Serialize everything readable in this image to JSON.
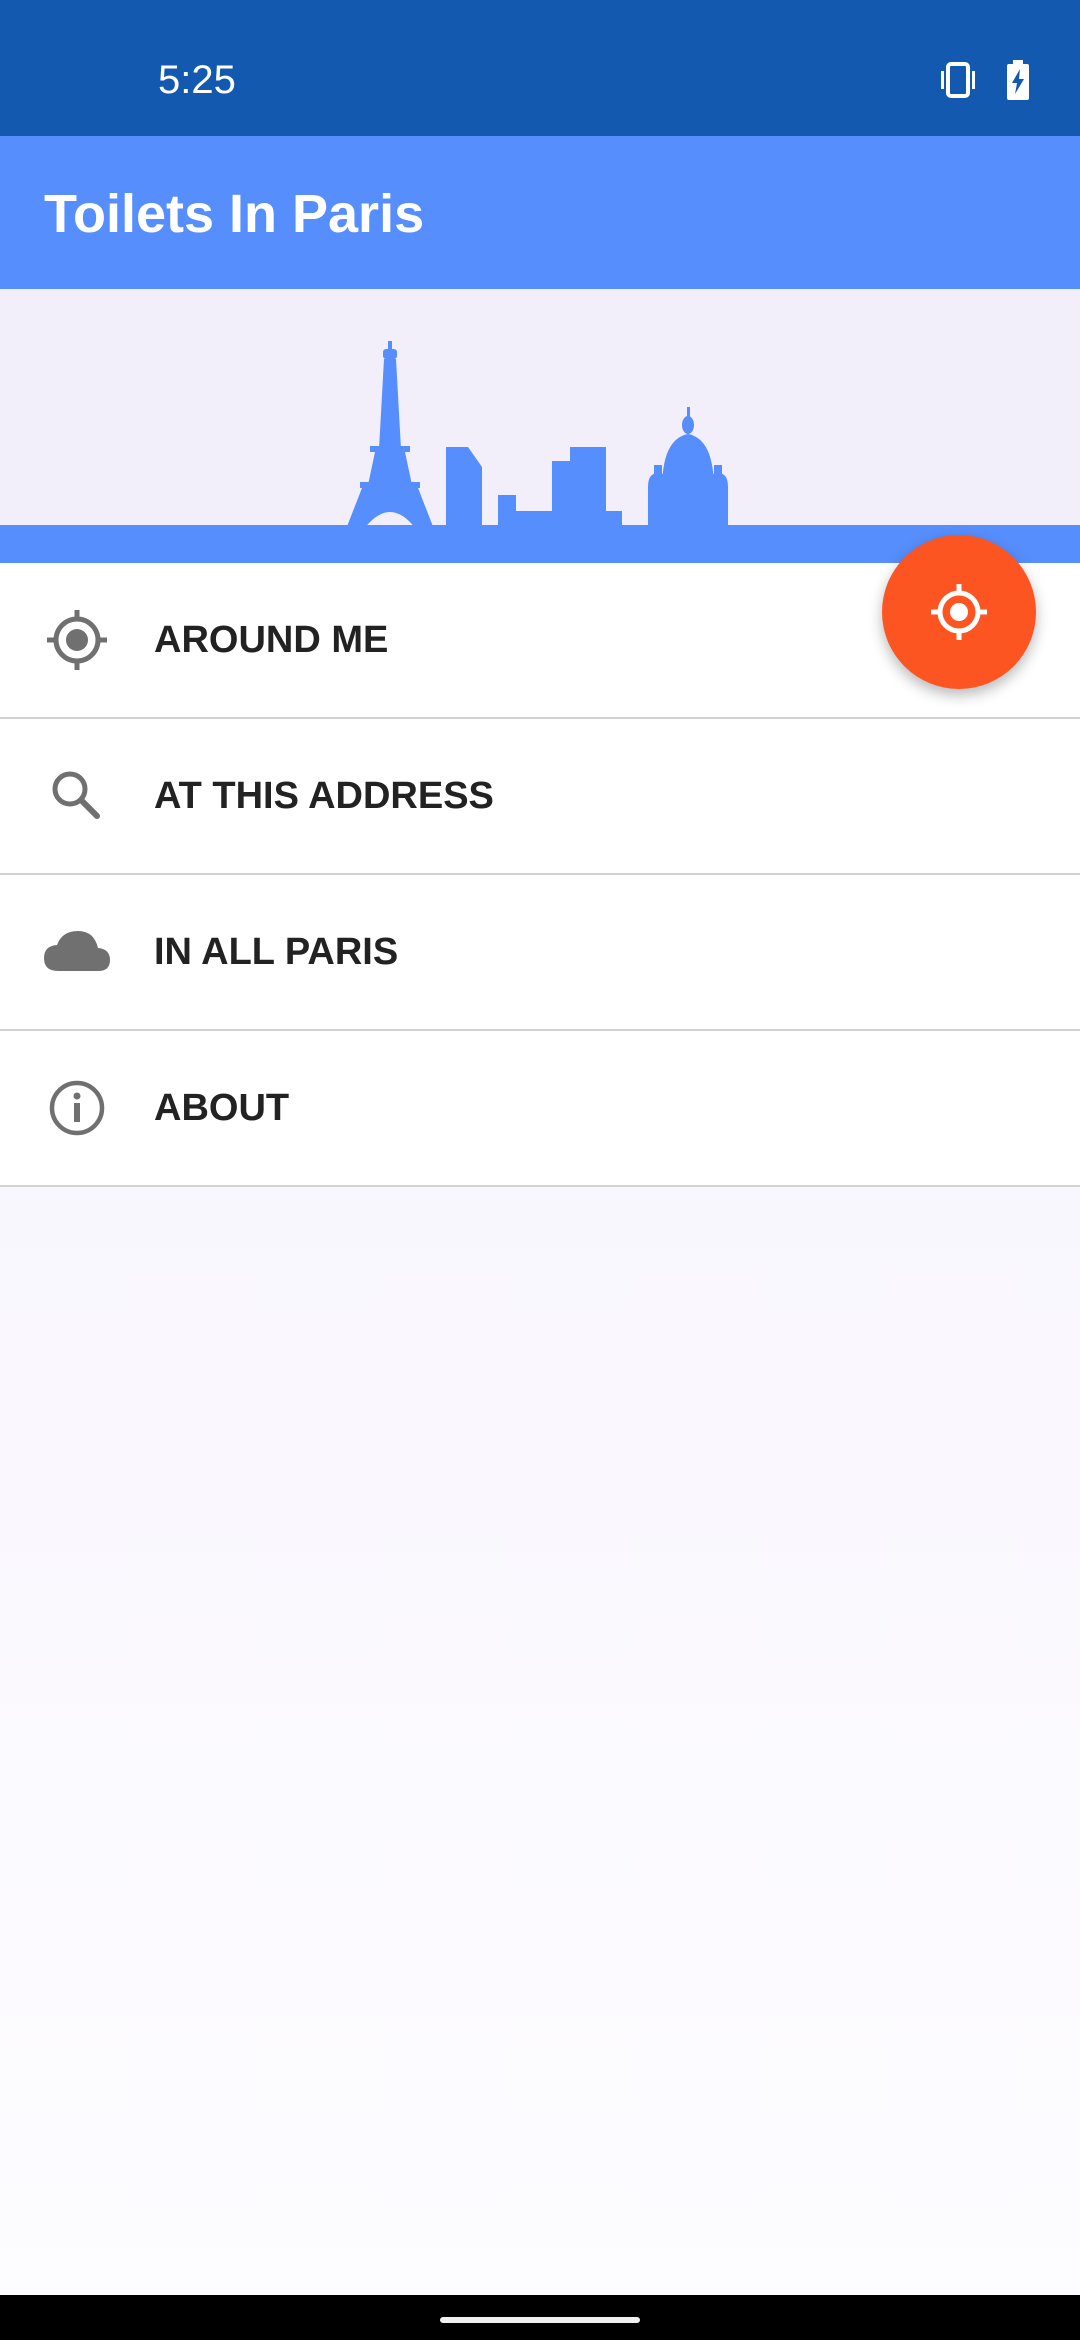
{
  "status_bar": {
    "time": "5:25",
    "icons": [
      "vibrate-icon",
      "battery-charging-icon"
    ]
  },
  "app_bar": {
    "title": "Toilets In Paris"
  },
  "header": {
    "illustration": "paris-skyline-icon"
  },
  "fab": {
    "icon": "my-location-icon",
    "color": "#fd5522"
  },
  "menu": {
    "items": [
      {
        "label": "AROUND ME",
        "icon": "crosshair-icon"
      },
      {
        "label": "AT THIS ADDRESS",
        "icon": "search-icon"
      },
      {
        "label": "IN ALL PARIS",
        "icon": "cloud-icon"
      },
      {
        "label": "ABOUT",
        "icon": "info-icon"
      }
    ]
  },
  "colors": {
    "status_bar": "#1359b0",
    "primary": "#578efd",
    "accent": "#fd5522",
    "icon": "#707070",
    "text": "#222222"
  }
}
